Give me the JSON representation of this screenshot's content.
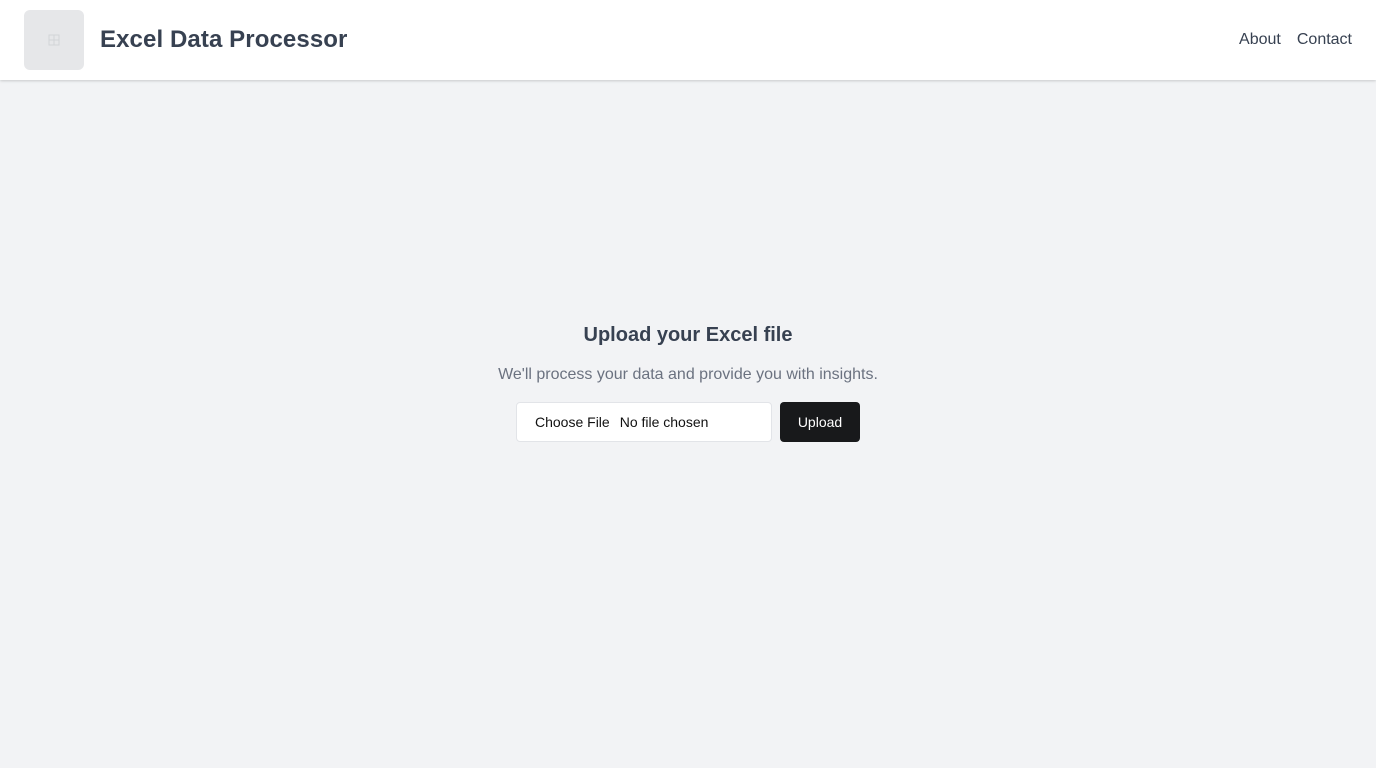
{
  "header": {
    "logo_icon": "grid-logo-icon",
    "title": "Excel Data Processor",
    "nav": [
      {
        "label": "About"
      },
      {
        "label": "Contact"
      }
    ]
  },
  "main": {
    "title": "Upload your Excel file",
    "subtitle": "We'll process your data and provide you with insights.",
    "file_input": {
      "button_label": "Choose File",
      "status": "No file chosen"
    },
    "upload_label": "Upload"
  },
  "colors": {
    "background": "#f2f3f5",
    "header_background": "#ffffff",
    "text_primary": "#374151",
    "text_secondary": "#6b7280",
    "button_dark": "#18191b"
  }
}
